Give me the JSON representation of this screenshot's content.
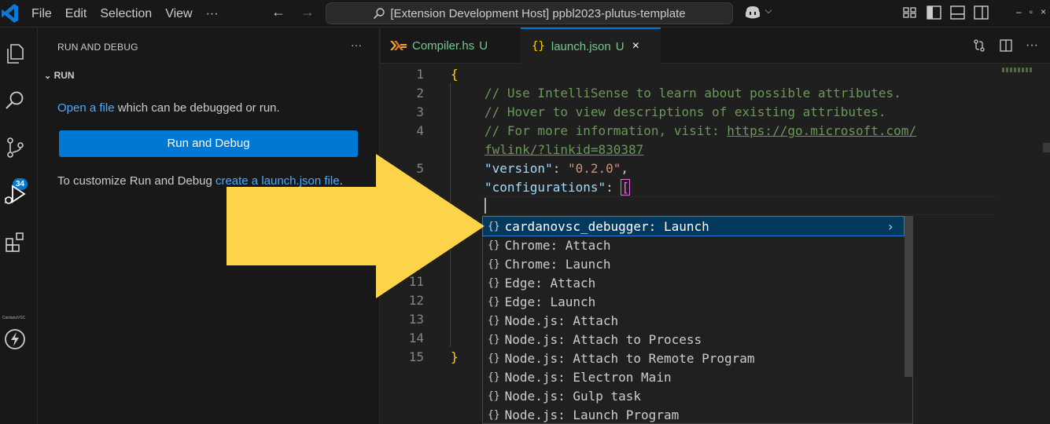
{
  "titlebar": {
    "menu": [
      "File",
      "Edit",
      "Selection",
      "View",
      "···"
    ],
    "nav_back": "←",
    "nav_forward": "→",
    "search_text": "[Extension Development Host] ppbl2023-plutus-template",
    "copilot_caret": "⌵",
    "window_buttons": [
      "–",
      "▫",
      "×"
    ]
  },
  "activitybar": {
    "scm_badge": "34",
    "cardano_label": "CardanoVSC"
  },
  "sidebar": {
    "title": "RUN AND DEBUG",
    "more": "···",
    "section": "RUN",
    "open_file_link": "Open a file",
    "open_file_rest": " which can be debugged or run.",
    "run_button": "Run and Debug",
    "customize_text": "To customize Run and Debug ",
    "create_link": "create a launch.json file",
    "customize_end": "."
  },
  "tabs": [
    {
      "label": "Compiler.hs",
      "status": "U"
    },
    {
      "label": "launch.json",
      "status": "U",
      "close": "×"
    }
  ],
  "editor": {
    "line_numbers": [
      "1",
      "2",
      "3",
      "4",
      "5",
      "11",
      "12",
      "13",
      "14",
      "15"
    ],
    "line1": "{",
    "line2": "// Use IntelliSense to learn about possible attributes.",
    "line3": "// Hover to view descriptions of existing attributes.",
    "line4a": "// For more information, visit: ",
    "line4_url": "https://go.microsoft.com/",
    "line4b": "fwlink/?linkid=830387",
    "version_key": "\"version\"",
    "version_sep": ": ",
    "version_val": "\"0.2.0\"",
    "version_comma": ",",
    "config_key": "\"configurations\"",
    "config_sep": ": ",
    "config_bracket": "[",
    "close_brace": "}"
  },
  "suggestions": {
    "icon": "{}",
    "items": [
      "cardanovsc_debugger: Launch",
      "Chrome: Attach",
      "Chrome: Launch",
      "Edge: Attach",
      "Edge: Launch",
      "Node.js: Attach",
      "Node.js: Attach to Process",
      "Node.js: Attach to Remote Program",
      "Node.js: Electron Main",
      "Node.js: Gulp task",
      "Node.js: Launch Program"
    ],
    "chevron": "›"
  },
  "colors": {
    "accent": "#0078d4",
    "arrow": "#fdd449",
    "untracked": "#73c991"
  }
}
